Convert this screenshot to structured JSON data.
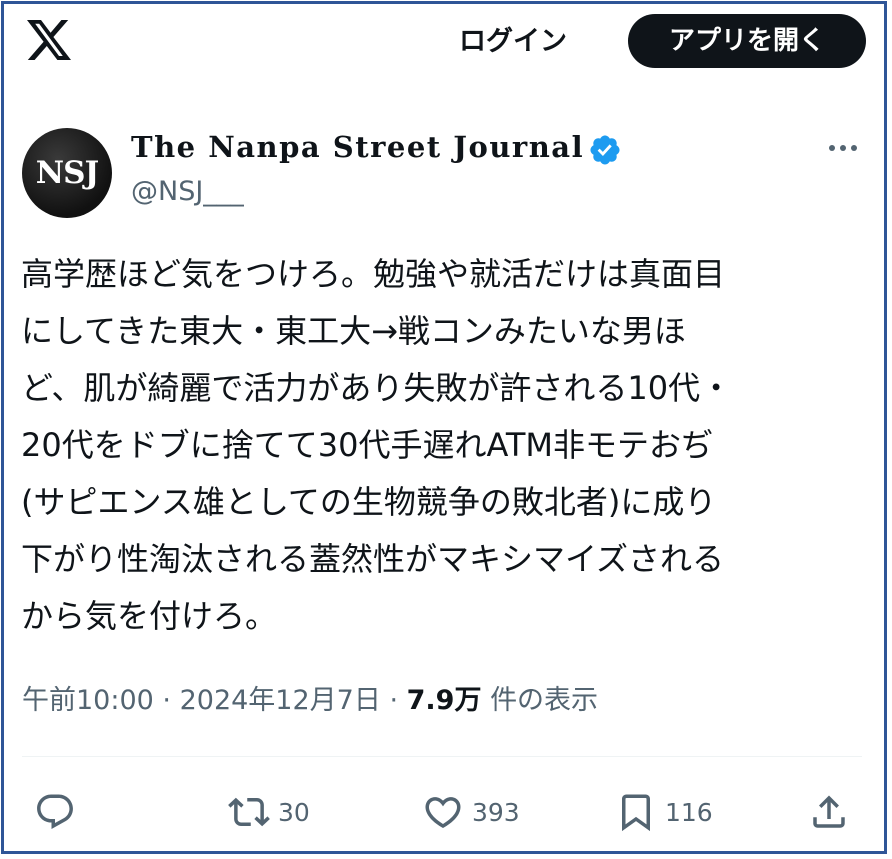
{
  "header": {
    "login_label": "ログイン",
    "open_app_label": "アプリを開く"
  },
  "author": {
    "avatar_text": "NSJ",
    "display_name": "The Nanpa Street Journal",
    "handle": "@NSJ___"
  },
  "tweet": {
    "text": "高学歴ほど気をつけろ。勉強や就活だけは真面目\nにしてきた東大・東工大→戦コンみたいな男ほ\nど、肌が綺麗で活力があり失敗が許される10代・\n20代をドブに捨てて30代手遅れATM非モテおぢ\n(サピエンス雄としての生物競争の敗北者)に成り\n下がり性淘汰される蓋然性がマキシマイズされる\nから気を付けろ。"
  },
  "meta": {
    "time": "午前10:00",
    "separator": "·",
    "date": "2024年12月7日",
    "views_count": "7.9万",
    "views_label": "件の表示"
  },
  "actions": {
    "reply_count": "",
    "retweet_count": "30",
    "like_count": "393",
    "bookmark_count": "116"
  },
  "colors": {
    "frame_border": "#2f5597",
    "verified": "#1d9bf0",
    "secondary_text": "#536471",
    "primary_text": "#0f1419"
  }
}
